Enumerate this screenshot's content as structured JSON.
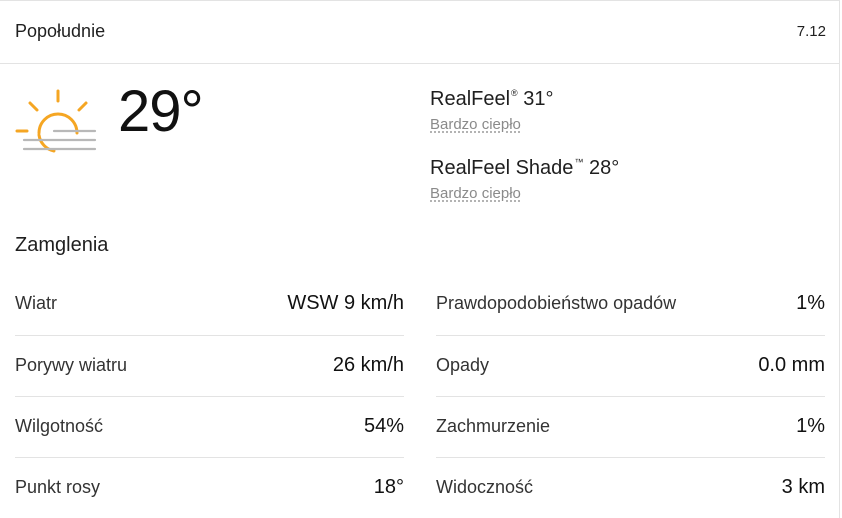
{
  "header": {
    "title": "Popołudnie",
    "date": "7.12"
  },
  "current": {
    "icon": "sun-haze-icon",
    "temperature": "29°",
    "realfeel_label": "RealFeel",
    "realfeel_mark": "®",
    "realfeel_value": "31°",
    "realfeel_desc": "Bardzo ciepło",
    "realfeel_shade_label": "RealFeel Shade",
    "realfeel_shade_mark": "™",
    "realfeel_shade_value": "28°",
    "realfeel_shade_desc": "Bardzo ciepło",
    "phrase": "Zamglenia"
  },
  "details": {
    "left": [
      {
        "label": "Wiatr",
        "value": "WSW 9 km/h"
      },
      {
        "label": "Porywy wiatru",
        "value": "26 km/h"
      },
      {
        "label": "Wilgotność",
        "value": "54%"
      },
      {
        "label": "Punkt rosy",
        "value": "18°"
      }
    ],
    "right": [
      {
        "label": "Prawdopodobieństwo opadów",
        "value": "1%"
      },
      {
        "label": "Opady",
        "value": "0.0 mm"
      },
      {
        "label": "Zachmurzenie",
        "value": "1%"
      },
      {
        "label": "Widoczność",
        "value": "3 km"
      }
    ]
  },
  "colors": {
    "sun": "#f5a623",
    "haze": "#b8b8b8",
    "divider": "#e3e3e3",
    "muted_text": "#8a8a8a"
  }
}
